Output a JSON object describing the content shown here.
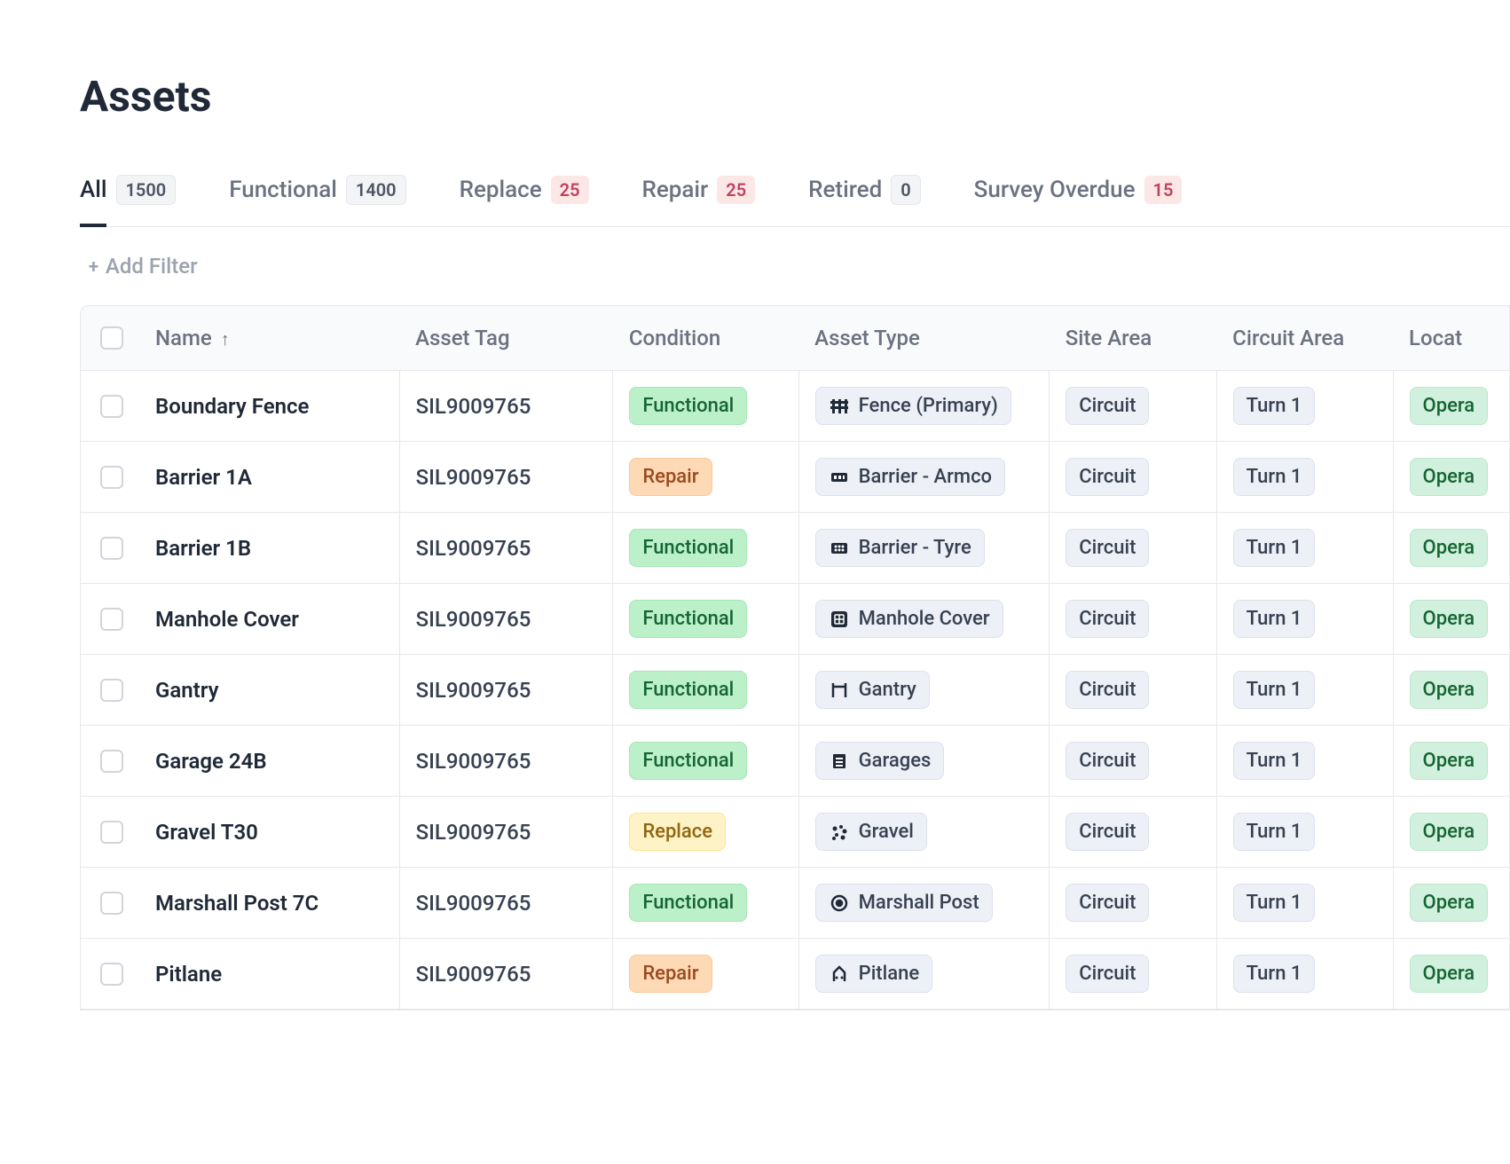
{
  "page_title": "Assets",
  "tabs": [
    {
      "label": "All",
      "count": "1500",
      "style": "neutral",
      "active": true
    },
    {
      "label": "Functional",
      "count": "1400",
      "style": "neutral",
      "active": false
    },
    {
      "label": "Replace",
      "count": "25",
      "style": "red",
      "active": false
    },
    {
      "label": "Repair",
      "count": "25",
      "style": "red",
      "active": false
    },
    {
      "label": "Retired",
      "count": "0",
      "style": "neutral",
      "active": false
    },
    {
      "label": "Survey Overdue",
      "count": "15",
      "style": "red",
      "active": false
    }
  ],
  "add_filter_label": "Add Filter",
  "columns": {
    "name": "Name",
    "asset_tag": "Asset Tag",
    "condition": "Condition",
    "asset_type": "Asset Type",
    "site_area": "Site Area",
    "circuit_area": "Circuit Area",
    "location": "Locat"
  },
  "rows": [
    {
      "name": "Boundary Fence",
      "tag": "SIL9009765",
      "condition": "Functional",
      "condition_style": "functional",
      "type": "Fence (Primary)",
      "type_icon": "fence",
      "site": "Circuit",
      "circuit": "Turn 1",
      "location": "Opera"
    },
    {
      "name": "Barrier 1A",
      "tag": "SIL9009765",
      "condition": "Repair",
      "condition_style": "repair",
      "type": "Barrier - Armco",
      "type_icon": "armco",
      "site": "Circuit",
      "circuit": "Turn 1",
      "location": "Opera"
    },
    {
      "name": "Barrier 1B",
      "tag": "SIL9009765",
      "condition": "Functional",
      "condition_style": "functional",
      "type": "Barrier - Tyre",
      "type_icon": "tyre",
      "site": "Circuit",
      "circuit": "Turn 1",
      "location": "Opera"
    },
    {
      "name": "Manhole Cover",
      "tag": "SIL9009765",
      "condition": "Functional",
      "condition_style": "functional",
      "type": "Manhole Cover",
      "type_icon": "manhole",
      "site": "Circuit",
      "circuit": "Turn 1",
      "location": "Opera"
    },
    {
      "name": "Gantry",
      "tag": "SIL9009765",
      "condition": "Functional",
      "condition_style": "functional",
      "type": "Gantry",
      "type_icon": "gantry",
      "site": "Circuit",
      "circuit": "Turn 1",
      "location": "Opera"
    },
    {
      "name": "Garage 24B",
      "tag": "SIL9009765",
      "condition": "Functional",
      "condition_style": "functional",
      "type": "Garages",
      "type_icon": "garage",
      "site": "Circuit",
      "circuit": "Turn 1",
      "location": "Opera"
    },
    {
      "name": "Gravel T30",
      "tag": "SIL9009765",
      "condition": "Replace",
      "condition_style": "replace",
      "type": "Gravel",
      "type_icon": "gravel",
      "site": "Circuit",
      "circuit": "Turn 1",
      "location": "Opera"
    },
    {
      "name": "Marshall Post 7C",
      "tag": "SIL9009765",
      "condition": "Functional",
      "condition_style": "functional",
      "type": "Marshall Post",
      "type_icon": "marshall",
      "site": "Circuit",
      "circuit": "Turn 1",
      "location": "Opera"
    },
    {
      "name": "Pitlane",
      "tag": "SIL9009765",
      "condition": "Repair",
      "condition_style": "repair",
      "type": "Pitlane",
      "type_icon": "pitlane",
      "site": "Circuit",
      "circuit": "Turn 1",
      "location": "Opera"
    }
  ]
}
